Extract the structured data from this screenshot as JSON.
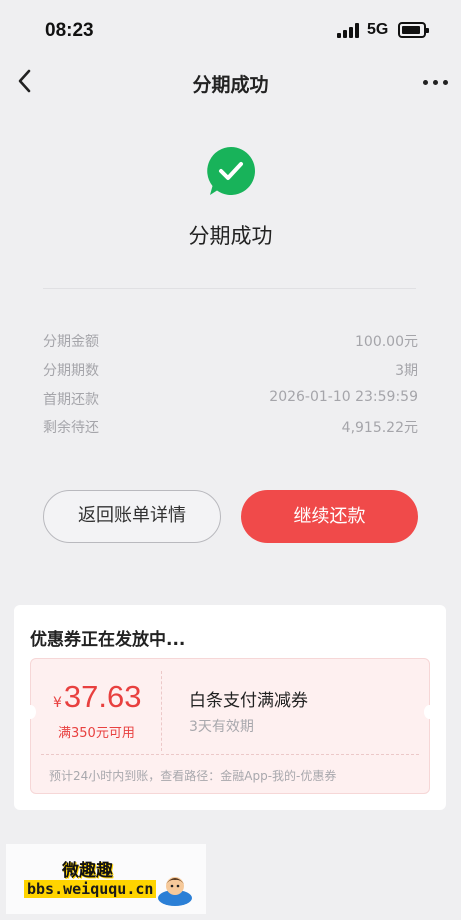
{
  "status_bar": {
    "time": "08:23",
    "network": "5G"
  },
  "nav": {
    "title": "分期成功"
  },
  "result": {
    "title": "分期成功",
    "accent_color": "#18b35a"
  },
  "details": [
    {
      "label": "分期金额",
      "value": "100.00元"
    },
    {
      "label": "分期期数",
      "value": "3期"
    },
    {
      "label": "首期还款",
      "value": "2026-01-10 23:59:59"
    },
    {
      "label": "剩余待还",
      "value": "4,915.22元"
    }
  ],
  "buttons": {
    "return_label": "返回账单详情",
    "continue_label": "继续还款",
    "primary_color": "#f04a4a"
  },
  "coupon": {
    "heading": "优惠券正在发放中...",
    "currency": "¥",
    "amount": "37.63",
    "threshold": "满350元可用",
    "name": "白条支付满减券",
    "validity": "3天有效期",
    "note": "预计24小时内到账，查看路径：金融App-我的-优惠券"
  },
  "watermark": {
    "title": "微趣趣",
    "url": "bbs.weiququ.cn"
  }
}
